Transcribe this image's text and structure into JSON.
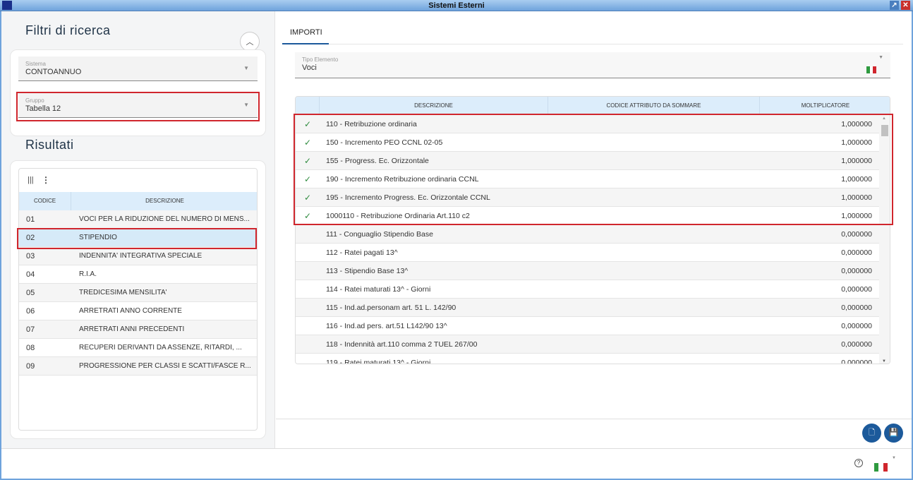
{
  "window": {
    "title": "Sistemi Esterni"
  },
  "filters": {
    "title": "Filtri di ricerca",
    "sistema": {
      "label": "Sistema",
      "value": "CONTOANNUO"
    },
    "gruppo": {
      "label": "Gruppo",
      "value": "Tabella 12"
    }
  },
  "results": {
    "title": "Risultati",
    "columns": [
      "CODICE",
      "DESCRIZIONE"
    ],
    "rows": [
      {
        "code": "01",
        "desc": "VOCI PER LA RIDUZIONE DEL NUMERO DI MENS..."
      },
      {
        "code": "02",
        "desc": "STIPENDIO",
        "selected": true
      },
      {
        "code": "03",
        "desc": "INDENNITA' INTEGRATIVA SPECIALE"
      },
      {
        "code": "04",
        "desc": "R.I.A."
      },
      {
        "code": "05",
        "desc": "TREDICESIMA MENSILITA'"
      },
      {
        "code": "06",
        "desc": "ARRETRATI ANNO CORRENTE"
      },
      {
        "code": "07",
        "desc": "ARRETRATI ANNI PRECEDENTI"
      },
      {
        "code": "08",
        "desc": "RECUPERI DERIVANTI DA ASSENZE, RITARDI, ..."
      },
      {
        "code": "09",
        "desc": "PROGRESSIONE PER CLASSI E SCATTI/FASCE R..."
      }
    ]
  },
  "tabs": [
    {
      "label": "IMPORTI",
      "active": true
    }
  ],
  "tipo_elemento": {
    "label": "Tipo Elemento",
    "value": "Voci"
  },
  "importi": {
    "columns": [
      "DESCRIZIONE",
      "CODICE ATTRIBUTO DA SOMMARE",
      "MOLTIPLICATORE"
    ],
    "rows": [
      {
        "checked": true,
        "desc": "110 - Retribuzione ordinaria",
        "codice": "",
        "molt": "1,000000"
      },
      {
        "checked": true,
        "desc": "150 - Incremento PEO CCNL 02-05",
        "codice": "",
        "molt": "1,000000"
      },
      {
        "checked": true,
        "desc": "155 - Progress. Ec. Orizzontale",
        "codice": "",
        "molt": "1,000000"
      },
      {
        "checked": true,
        "desc": "190 - Incremento Retribuzione ordinaria CCNL",
        "codice": "",
        "molt": "1,000000"
      },
      {
        "checked": true,
        "desc": "195 - Incremento Progress. Ec. Orizzontale CCNL",
        "codice": "",
        "molt": "1,000000"
      },
      {
        "checked": true,
        "desc": "1000110 - Retribuzione Ordinaria Art.110 c2",
        "codice": "",
        "molt": "1,000000"
      },
      {
        "checked": false,
        "desc": "111 - Conguaglio Stipendio Base",
        "codice": "",
        "molt": "0,000000"
      },
      {
        "checked": false,
        "desc": "112 - Ratei pagati 13^",
        "codice": "",
        "molt": "0,000000"
      },
      {
        "checked": false,
        "desc": "113 - Stipendio Base 13^",
        "codice": "",
        "molt": "0,000000"
      },
      {
        "checked": false,
        "desc": "114 - Ratei maturati 13^ - Giorni",
        "codice": "",
        "molt": "0,000000"
      },
      {
        "checked": false,
        "desc": "115 - Ind.ad.personam art. 51 L. 142/90",
        "codice": "",
        "molt": "0,000000"
      },
      {
        "checked": false,
        "desc": "116 - Ind.ad pers. art.51 L142/90 13^",
        "codice": "",
        "molt": "0,000000"
      },
      {
        "checked": false,
        "desc": "118 - Indennità art.110 comma 2 TUEL 267/00",
        "codice": "",
        "molt": "0,000000"
      },
      {
        "checked": false,
        "desc": "119 - Ratei maturati 13^ - Giorni",
        "codice": "",
        "molt": "0,000000"
      }
    ]
  },
  "icons": {
    "check": "check-icon",
    "new": "new-document-icon",
    "save": "save-icon",
    "help": "help-icon",
    "flag": "italian-flag-icon"
  },
  "colors": {
    "accent": "#1c5a9b",
    "highlight": "#d0262d",
    "header": "#dcedfb",
    "check": "#2e8b3e"
  }
}
